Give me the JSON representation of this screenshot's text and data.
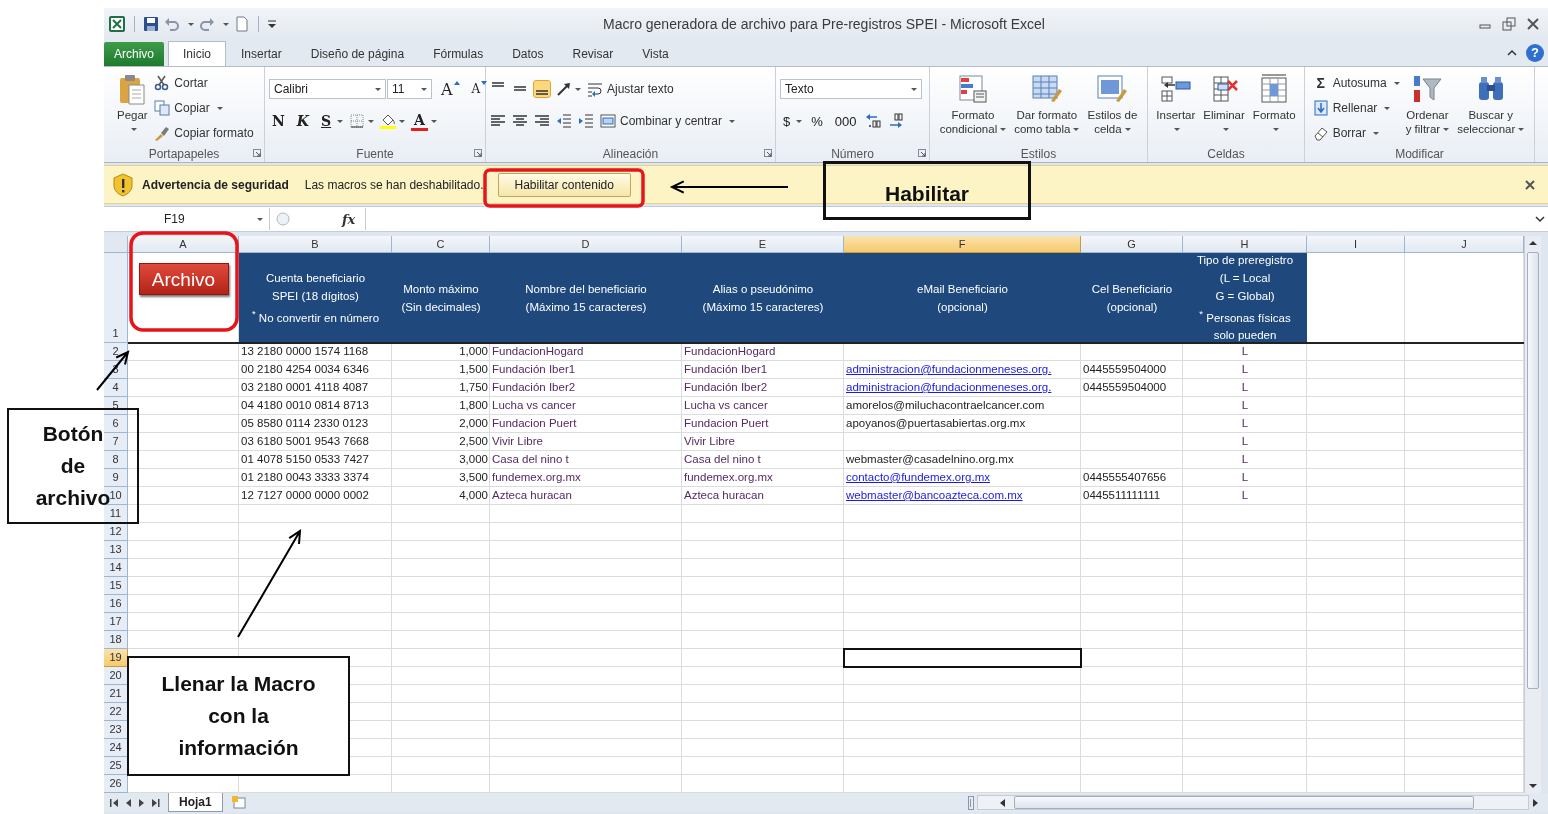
{
  "window": {
    "title": "Macro generadora de archivo para Pre-registros SPEI  -  Microsoft Excel",
    "help": "?"
  },
  "ribbon_tabs": [
    {
      "label": "Archivo",
      "kind": "file",
      "selected": false
    },
    {
      "label": "Inicio",
      "kind": "tab",
      "selected": true
    },
    {
      "label": "Insertar",
      "kind": "tab",
      "selected": false
    },
    {
      "label": "Diseño de página",
      "kind": "tab",
      "selected": false
    },
    {
      "label": "Fórmulas",
      "kind": "tab",
      "selected": false
    },
    {
      "label": "Datos",
      "kind": "tab",
      "selected": false
    },
    {
      "label": "Revisar",
      "kind": "tab",
      "selected": false
    },
    {
      "label": "Vista",
      "kind": "tab",
      "selected": false
    }
  ],
  "ribbon_groups": [
    {
      "label": "Portapapeles",
      "launcher": true,
      "items": [
        {
          "kind": "large",
          "lines": [
            "Pegar"
          ],
          "menu": true
        },
        {
          "kind": "small",
          "label": "Cortar",
          "menu": false
        },
        {
          "kind": "small",
          "label": "Copiar",
          "menu": true
        },
        {
          "kind": "small",
          "label": "Copiar formato",
          "menu": false
        }
      ]
    },
    {
      "label": "Fuente",
      "launcher": true,
      "items": [
        {
          "kind": "toolbar",
          "lines": [
            {
              "controls": [
                {
                  "kind": "combo",
                  "value": "Calibri"
                },
                {
                  "kind": "combo",
                  "value": "11"
                },
                {
                  "kind": "glyph",
                  "text": "A",
                  "menu": false
                },
                {
                  "kind": "glyph",
                  "text": "A",
                  "menu": false
                }
              ]
            },
            {
              "controls": [
                {
                  "kind": "glyph",
                  "text": "N",
                  "menu": false
                },
                {
                  "kind": "glyph",
                  "text": "K",
                  "menu": false
                },
                {
                  "kind": "glyph",
                  "text": "S",
                  "menu": true
                },
                {
                  "kind": "icon",
                  "menu": true
                },
                {
                  "kind": "icon",
                  "menu": true
                },
                {
                  "kind": "glyph",
                  "text": "A",
                  "menu": true
                }
              ]
            }
          ]
        }
      ]
    },
    {
      "label": "Alineación",
      "launcher": true,
      "items": [
        {
          "kind": "toolbar",
          "lines": [
            {
              "controls": [
                {
                  "kind": "icon",
                  "selected": false,
                  "menu": false
                },
                {
                  "kind": "icon",
                  "selected": false,
                  "menu": false
                },
                {
                  "kind": "icon",
                  "selected": true,
                  "menu": false
                },
                {
                  "kind": "icon",
                  "menu": true
                },
                {
                  "kind": "small",
                  "label": "Ajustar texto",
                  "menu": false
                }
              ]
            },
            {
              "controls": [
                {
                  "kind": "icon",
                  "selected": false,
                  "menu": false
                },
                {
                  "kind": "icon",
                  "selected": false,
                  "menu": false
                },
                {
                  "kind": "icon",
                  "selected": false,
                  "menu": false
                },
                {
                  "kind": "icon",
                  "menu": false
                },
                {
                  "kind": "icon",
                  "menu": false
                },
                {
                  "kind": "small",
                  "label": "Combinar y centrar",
                  "menu": true
                }
              ]
            }
          ]
        }
      ]
    },
    {
      "label": "Número",
      "launcher": true,
      "items": [
        {
          "kind": "toolbar",
          "lines": [
            {
              "controls": [
                {
                  "kind": "combo",
                  "value": "Texto"
                }
              ]
            },
            {
              "controls": [
                {
                  "kind": "glyph",
                  "text": "$",
                  "menu": true
                },
                {
                  "kind": "glyph",
                  "text": "%",
                  "menu": false
                },
                {
                  "kind": "glyph",
                  "text": "000",
                  "menu": false
                },
                {
                  "kind": "icon",
                  "menu": false
                },
                {
                  "kind": "icon",
                  "menu": false
                }
              ]
            }
          ]
        }
      ]
    },
    {
      "label": "Estilos",
      "launcher": false,
      "items": [
        {
          "kind": "large",
          "lines": [
            "Formato",
            "condicional"
          ],
          "menu": true
        },
        {
          "kind": "large",
          "lines": [
            "Dar formato",
            "como tabla"
          ],
          "menu": true
        },
        {
          "kind": "large",
          "lines": [
            "Estilos de",
            "celda"
          ],
          "menu": true
        }
      ]
    },
    {
      "label": "Celdas",
      "launcher": false,
      "items": [
        {
          "kind": "large",
          "lines": [
            "Insertar"
          ],
          "menu": true
        },
        {
          "kind": "large",
          "lines": [
            "Eliminar"
          ],
          "menu": true
        },
        {
          "kind": "large",
          "lines": [
            "Formato"
          ],
          "menu": true
        }
      ]
    },
    {
      "label": "Modificar",
      "launcher": false,
      "items": [
        {
          "kind": "small",
          "label": "Autosuma",
          "glyph": "Σ",
          "menu": true
        },
        {
          "kind": "small",
          "label": "Rellenar",
          "menu": true
        },
        {
          "kind": "small",
          "label": "Borrar",
          "menu": true
        },
        {
          "kind": "large",
          "lines": [
            "Ordenar",
            "y filtrar"
          ],
          "menu": true
        },
        {
          "kind": "large",
          "lines": [
            "Buscar y",
            "seleccionar"
          ],
          "menu": true
        }
      ]
    }
  ],
  "security_bar": {
    "title": "Advertencia de seguridad",
    "message": "Las macros se han deshabilitado.",
    "button": "Habilitar contenido"
  },
  "formula_bar": {
    "name_box": "F19",
    "function_label": "fx"
  },
  "sheet": {
    "columns": [
      {
        "label": "A",
        "selected": false
      },
      {
        "label": "B",
        "selected": false
      },
      {
        "label": "C",
        "selected": false
      },
      {
        "label": "D",
        "selected": false
      },
      {
        "label": "E",
        "selected": false
      },
      {
        "label": "F",
        "selected": true
      },
      {
        "label": "G",
        "selected": false
      },
      {
        "label": "H",
        "selected": false
      },
      {
        "label": "I",
        "selected": false
      },
      {
        "label": "J",
        "selected": false
      }
    ],
    "rows": [
      {
        "number": "1",
        "selected": false,
        "kind": "header",
        "button": "Archivo",
        "headers": [
          [
            "Cuenta beneficiario",
            "SPEI (18 dígitos)",
            "$^{*}$ No convertir en número"
          ],
          [
            "Monto máximo",
            "(Sin decimales)"
          ],
          [
            "Nombre del beneficiario",
            "(Máximo 15 caracteres)"
          ],
          [
            "Alias o pseudónimo",
            "(Máximo 15 caracteres)"
          ],
          [
            "eMail Beneficiario",
            "(opcional)"
          ],
          [
            "Cel Beneficiario",
            "(opcional)"
          ],
          [
            "Tipo de preregistro",
            "(L = Local",
            "G = Global)",
            "$^{*}$ Personas físicas",
            "solo pueden"
          ]
        ]
      },
      {
        "number": "2",
        "selected": false,
        "kind": "data",
        "cells": {
          "account": {
            "text": "13 2180 0000 1574 1168"
          },
          "amount": {
            "text": "1,000"
          },
          "beneficiary": {
            "text": "FundacionHogard"
          },
          "alias": {
            "text": "FundacionHogard"
          },
          "type": {
            "text": "L"
          }
        }
      },
      {
        "number": "3",
        "selected": false,
        "kind": "data",
        "cells": {
          "account": {
            "text": "00 2180 4254 0034 6346"
          },
          "amount": {
            "text": "1,500"
          },
          "beneficiary": {
            "text": "Fundación Iber1"
          },
          "alias": {
            "text": "Fundación Iber1"
          },
          "email": {
            "text": "administracion@fundacionmeneses.org.",
            "link": true
          },
          "phone": {
            "text": "0445559504000"
          },
          "type": {
            "text": "L"
          }
        }
      },
      {
        "number": "4",
        "selected": false,
        "kind": "data",
        "cells": {
          "account": {
            "text": "03 2180 0001 4118 4087"
          },
          "amount": {
            "text": "1,750"
          },
          "beneficiary": {
            "text": "Fundación Iber2"
          },
          "alias": {
            "text": "Fundación Iber2"
          },
          "email": {
            "text": "administracion@fundacionmeneses.org.",
            "link": true
          },
          "phone": {
            "text": "0445559504000"
          },
          "type": {
            "text": "L"
          }
        }
      },
      {
        "number": "5",
        "selected": false,
        "kind": "data",
        "cells": {
          "account": {
            "text": "04 4180 0010 0814 8713"
          },
          "amount": {
            "text": "1,800"
          },
          "beneficiary": {
            "text": "Lucha vs cancer"
          },
          "alias": {
            "text": "Lucha vs cancer"
          },
          "email": {
            "text": "amorelos@miluchacontraelcancer.com",
            "link": false
          },
          "type": {
            "text": "L"
          }
        }
      },
      {
        "number": "6",
        "selected": false,
        "kind": "data",
        "cells": {
          "account": {
            "text": "05 8580 0114 2330 0123"
          },
          "amount": {
            "text": "2,000"
          },
          "beneficiary": {
            "text": "Fundacion Puert"
          },
          "alias": {
            "text": "Fundacion Puert"
          },
          "email": {
            "text": "apoyanos@puertasabiertas.org.mx",
            "link": false
          },
          "type": {
            "text": "L"
          }
        }
      },
      {
        "number": "7",
        "selected": false,
        "kind": "data",
        "cells": {
          "account": {
            "text": "03 6180 5001 9543 7668"
          },
          "amount": {
            "text": "2,500"
          },
          "beneficiary": {
            "text": "Vivir Libre"
          },
          "alias": {
            "text": "Vivir Libre"
          },
          "type": {
            "text": "L"
          }
        }
      },
      {
        "number": "8",
        "selected": false,
        "kind": "data",
        "cells": {
          "account": {
            "text": "01 4078 5150 0533 7427"
          },
          "amount": {
            "text": "3,000"
          },
          "beneficiary": {
            "text": "Casa del nino t"
          },
          "alias": {
            "text": "Casa del nino t"
          },
          "email": {
            "text": "webmaster@casadelnino.org.mx",
            "link": false
          },
          "type": {
            "text": "L"
          }
        }
      },
      {
        "number": "9",
        "selected": false,
        "kind": "data",
        "cells": {
          "account": {
            "text": "01 2180 0043 3333 3374"
          },
          "amount": {
            "text": "3,500"
          },
          "beneficiary": {
            "text": "fundemex.org.mx"
          },
          "alias": {
            "text": "fundemex.org.mx"
          },
          "email": {
            "text": "contacto@fundemex.org.mx",
            "link": true
          },
          "phone": {
            "text": "0445555407656"
          },
          "type": {
            "text": "L"
          }
        }
      },
      {
        "number": "10",
        "selected": false,
        "kind": "data",
        "cells": {
          "account": {
            "text": "12 7127 0000 0000 0002"
          },
          "amount": {
            "text": "4,000"
          },
          "beneficiary": {
            "text": "Azteca huracan"
          },
          "alias": {
            "text": "Azteca huracan"
          },
          "email": {
            "text": "webmaster@bancoazteca.com.mx",
            "link": true
          },
          "phone": {
            "text": "0445511111111"
          },
          "type": {
            "text": "L"
          }
        }
      },
      {
        "number": "11",
        "selected": false,
        "kind": "empty"
      },
      {
        "number": "12",
        "selected": false,
        "kind": "empty"
      },
      {
        "number": "13",
        "selected": false,
        "kind": "empty"
      },
      {
        "number": "14",
        "selected": false,
        "kind": "empty"
      },
      {
        "number": "15",
        "selected": false,
        "kind": "empty"
      },
      {
        "number": "16",
        "selected": false,
        "kind": "empty"
      },
      {
        "number": "17",
        "selected": false,
        "kind": "empty"
      },
      {
        "number": "18",
        "selected": false,
        "kind": "empty"
      },
      {
        "number": "19",
        "selected": true,
        "kind": "empty"
      },
      {
        "number": "20",
        "selected": false,
        "kind": "empty"
      },
      {
        "number": "21",
        "selected": false,
        "kind": "empty"
      },
      {
        "number": "22",
        "selected": false,
        "kind": "empty"
      },
      {
        "number": "23",
        "selected": false,
        "kind": "empty"
      },
      {
        "number": "24",
        "selected": false,
        "kind": "empty"
      },
      {
        "number": "25",
        "selected": false,
        "kind": "empty"
      },
      {
        "number": "26",
        "selected": false,
        "kind": "empty"
      }
    ],
    "tabs": [
      {
        "label": "Hoja1",
        "selected": true
      }
    ]
  },
  "callouts": [
    {
      "lines": [
        "Habilitar"
      ]
    },
    {
      "lines": [
        "Botón",
        "de",
        "archivo"
      ]
    },
    {
      "lines": [
        "Llenar la Macro",
        "con la",
        "información"
      ]
    }
  ]
}
